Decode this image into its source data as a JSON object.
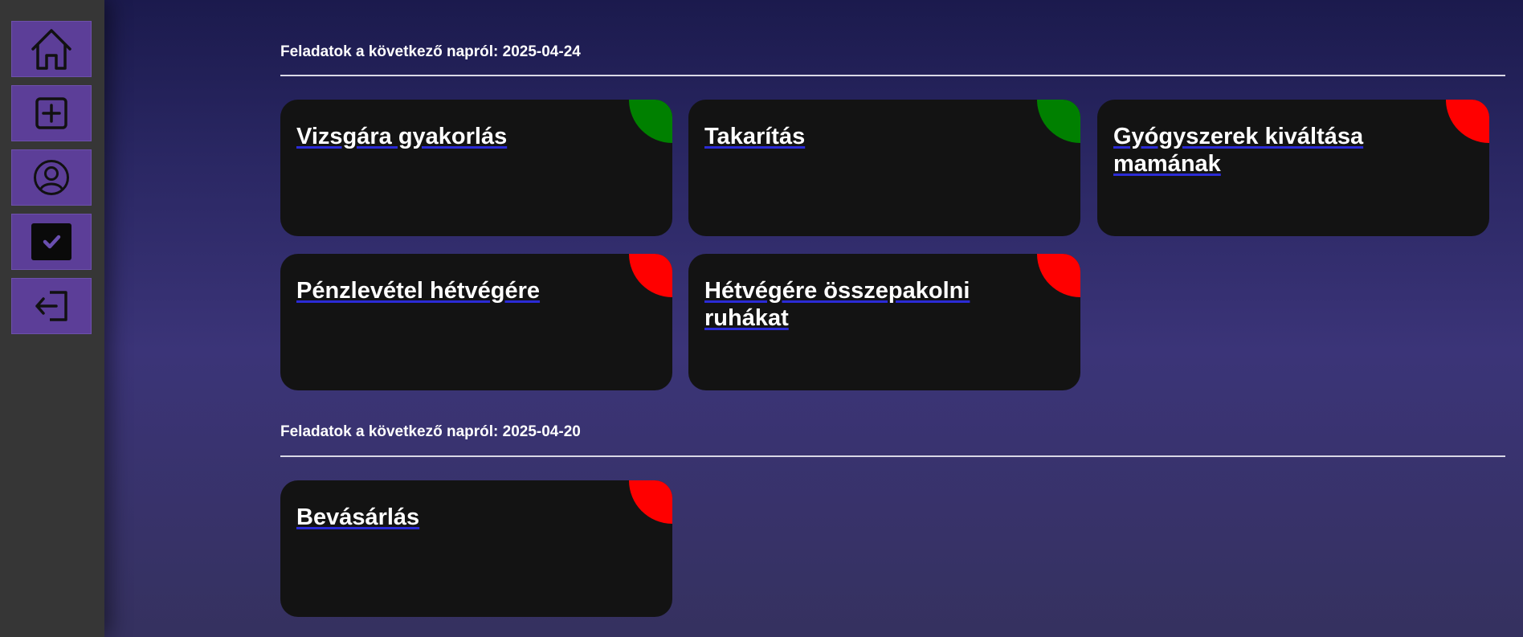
{
  "sidebar": {
    "items": [
      {
        "name": "home",
        "icon": "home-icon"
      },
      {
        "name": "add",
        "icon": "plus-square-icon"
      },
      {
        "name": "profile",
        "icon": "user-circle-icon"
      },
      {
        "name": "tasks",
        "icon": "checkbox-icon"
      },
      {
        "name": "logout",
        "icon": "logout-icon"
      }
    ],
    "button_color": "#5c3e98"
  },
  "colors": {
    "done": "#008000",
    "pending": "#ff0000",
    "card_bg": "#131313"
  },
  "sections": [
    {
      "header": "Feladatok a következő napról: 2025-04-24",
      "tasks": [
        {
          "title": "Vizsgára gyakorlás",
          "status": "done"
        },
        {
          "title": "Takarítás",
          "status": "done"
        },
        {
          "title": "Gyógyszerek kiváltása mamának",
          "status": "pending"
        },
        {
          "title": "Pénzlevétel hétvégére",
          "status": "pending"
        },
        {
          "title": "Hétvégére összepakolni ruhákat",
          "status": "pending"
        }
      ]
    },
    {
      "header": "Feladatok a következő napról: 2025-04-20",
      "tasks": [
        {
          "title": "Bevásárlás",
          "status": "pending"
        }
      ]
    }
  ]
}
